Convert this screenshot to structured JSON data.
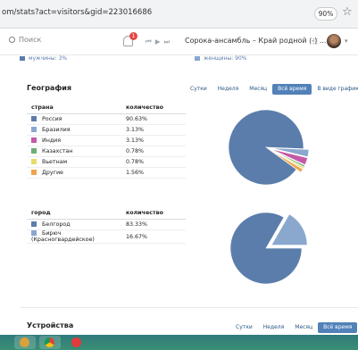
{
  "browser": {
    "url": "om/stats?act=visitors&gid=223016686",
    "zoom": "90%"
  },
  "topbar": {
    "search_placeholder": "Поиск",
    "notification_count": "1",
    "track": "Сорока-ансамбль – Край родной (-) ..."
  },
  "prev_legend": {
    "left": "мужчины: 3%",
    "right": "женщины: 90%"
  },
  "geo": {
    "title": "География",
    "periods": [
      "Сутки",
      "Неделя",
      "Месяц",
      "Всё время",
      "В виде графиков"
    ],
    "active_period": 3,
    "countries": {
      "headers": [
        "страна",
        "количество"
      ],
      "rows": [
        {
          "name": "Россия",
          "value": "90.63%",
          "color": "#5b7dab"
        },
        {
          "name": "Бразилия",
          "value": "3.13%",
          "color": "#8aa7ce"
        },
        {
          "name": "Индия",
          "value": "3.13%",
          "color": "#c559a8"
        },
        {
          "name": "Казахстан",
          "value": "0.78%",
          "color": "#6cae72"
        },
        {
          "name": "Вьетнам",
          "value": "0.78%",
          "color": "#e6dd6a"
        },
        {
          "name": "Другие",
          "value": "1.56%",
          "color": "#f0a44b"
        }
      ]
    },
    "cities": {
      "headers": [
        "город",
        "количество"
      ],
      "rows": [
        {
          "name": "Белгород",
          "value": "83.33%",
          "color": "#5b7dab"
        },
        {
          "name": "Бирюч (Красногвардейское)",
          "value": "16.67%",
          "color": "#8aa7ce"
        }
      ]
    }
  },
  "devices": {
    "title": "Устройства",
    "periods": [
      "Сутки",
      "Неделя",
      "Месяц",
      "Всё время"
    ],
    "active_period": 3
  },
  "chart_data": [
    {
      "type": "pie",
      "categories": [
        "Россия",
        "Бразилия",
        "Индия",
        "Казахстан",
        "Вьетнам",
        "Другие"
      ],
      "values": [
        90.63,
        3.13,
        3.13,
        0.78,
        0.78,
        1.56
      ],
      "colors": [
        "#5b7dab",
        "#8aa7ce",
        "#c559a8",
        "#6cae72",
        "#e6dd6a",
        "#f0a44b"
      ]
    },
    {
      "type": "pie",
      "categories": [
        "Белгород",
        "Бирюч (Красногвардейское)"
      ],
      "values": [
        83.33,
        16.67
      ],
      "colors": [
        "#5b7dab",
        "#8aa7ce"
      ]
    }
  ]
}
